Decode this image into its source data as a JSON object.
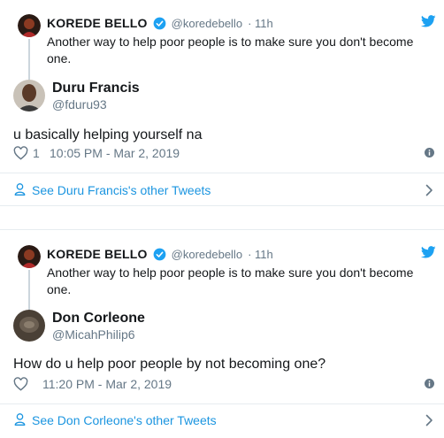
{
  "tweets": [
    {
      "parent": {
        "name": "KOREDE BELLO",
        "handle": "@koredebello",
        "time": "· 11h",
        "text": "Another way to help poor people is to make sure you don't become one."
      },
      "reply": {
        "name": "Duru Francis",
        "handle": "@fduru93",
        "text": "u basically helping yourself na",
        "likes": "1",
        "timestamp": "10:05 PM - Mar 2, 2019"
      },
      "more_link": "See Duru Francis's other Tweets"
    },
    {
      "parent": {
        "name": "KOREDE BELLO",
        "handle": "@koredebello",
        "time": "· 11h",
        "text": "Another way to help poor people is to make sure you don't become one."
      },
      "reply": {
        "name": "Don Corleone",
        "handle": "@MicahPhilip6",
        "text": "How do u help poor people by not becoming one?",
        "likes": "",
        "timestamp": "11:20 PM - Mar 2, 2019"
      },
      "more_link": "See Don Corleone's other Tweets"
    }
  ],
  "colors": {
    "brand": "#1da1f2",
    "link": "#1b95e0",
    "muted": "#657786",
    "border": "#e6ecf0"
  },
  "icons": [
    "twitter-bird-icon",
    "verified-badge-icon",
    "heart-icon",
    "info-icon",
    "person-icon",
    "chevron-right-icon"
  ]
}
